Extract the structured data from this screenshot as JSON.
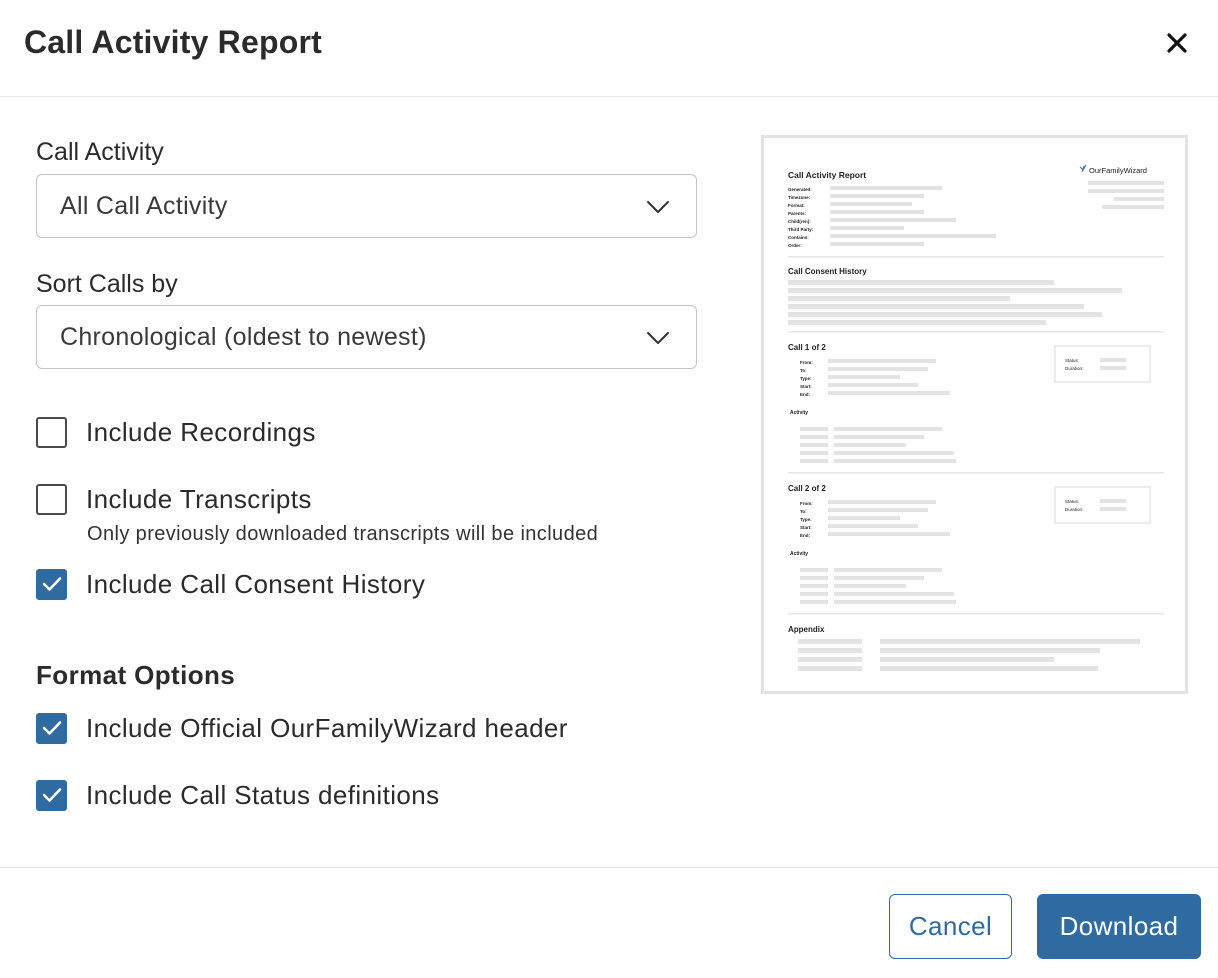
{
  "dialog": {
    "title": "Call Activity Report",
    "close_icon": "close-icon"
  },
  "call_activity": {
    "label": "Call Activity",
    "value": "All Call Activity",
    "icon": "chevron-down-icon"
  },
  "sort_calls": {
    "label": "Sort Calls by",
    "value": "Chronological (oldest to newest)",
    "icon": "chevron-down-icon"
  },
  "options": {
    "recordings": {
      "label": "Include Recordings",
      "checked": false
    },
    "transcripts": {
      "label": "Include Transcripts",
      "checked": false,
      "help": "Only previously downloaded transcripts will be included"
    },
    "consent_history": {
      "label": "Include Call Consent History",
      "checked": true
    }
  },
  "format_options": {
    "title": "Format Options",
    "official_header": {
      "label": "Include Official OurFamilyWizard header",
      "checked": true
    },
    "status_definitions": {
      "label": "Include Call Status definitions",
      "checked": true
    }
  },
  "preview": {
    "title": "Call Activity Report",
    "brand": "OurFamilyWizard",
    "meta_labels": [
      "Generated:",
      "Timezone:",
      "Format:",
      "Parents:",
      "Child(ren):",
      "Third Party:",
      "Contains:",
      "Order:"
    ],
    "consent_title": "Call Consent History",
    "calls": [
      {
        "title": "Call 1 of 2",
        "fields": [
          "From:",
          "To:",
          "Type:",
          "Start:",
          "End:"
        ],
        "status": "Status:",
        "duration": "Duration:",
        "activity": "Activity"
      },
      {
        "title": "Call 2 of 2",
        "fields": [
          "From:",
          "To:",
          "Type:",
          "Start:",
          "End:"
        ],
        "status": "Status:",
        "duration": "Duration:",
        "activity": "Activity"
      }
    ],
    "appendix_title": "Appendix"
  },
  "footer": {
    "cancel_label": "Cancel",
    "download_label": "Download"
  },
  "colors": {
    "accent": "#2f6aa0",
    "border": "#c4c4c4",
    "divider": "#e6e6e6"
  }
}
